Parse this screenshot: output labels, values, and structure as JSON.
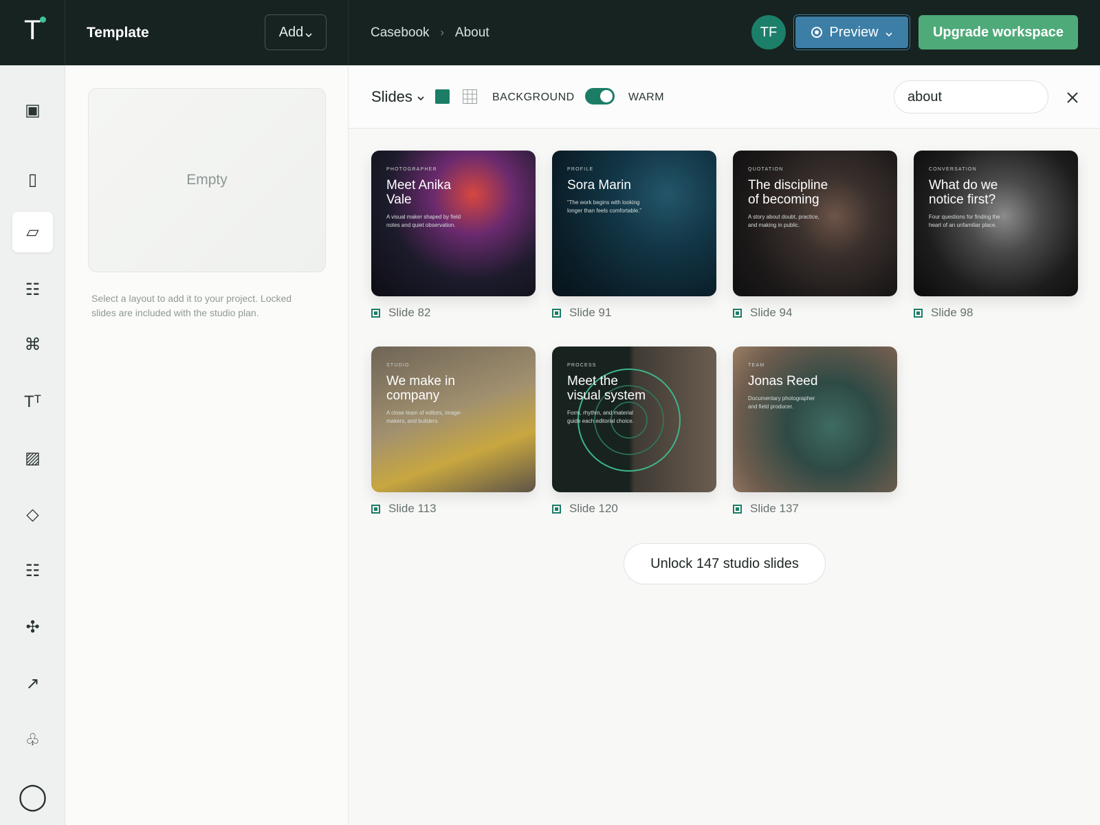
{
  "app": {
    "logo_letter": "T",
    "template_title": "Template",
    "add_label": "Add",
    "breadcrumbs": [
      "Casebook",
      "About"
    ],
    "avatar_initials": "TF",
    "preview_label": "Preview",
    "upgrade_label": "Upgrade workspace"
  },
  "rail": {
    "items": [
      {
        "name": "frame-icon",
        "glyph": "▣"
      },
      {
        "name": "column-icon",
        "glyph": "▯"
      },
      {
        "name": "parallelogram-icon",
        "glyph": "▱",
        "active": true
      },
      {
        "name": "list-icon",
        "glyph": "☷"
      },
      {
        "name": "command-icon",
        "glyph": "⌘"
      },
      {
        "name": "text-size-icon",
        "glyph": "Tᵀ"
      },
      {
        "name": "pattern-icon",
        "glyph": "▨"
      },
      {
        "name": "diamond-icon",
        "glyph": "◇"
      },
      {
        "name": "list-alt-icon",
        "glyph": "☷"
      },
      {
        "name": "nodes-icon",
        "glyph": "✣"
      },
      {
        "name": "arrow-icon",
        "glyph": "↗"
      },
      {
        "name": "club-icon",
        "glyph": "♧"
      },
      {
        "name": "circle-icon",
        "glyph": "◯"
      }
    ]
  },
  "panel": {
    "empty_label": "Empty",
    "note": "Select a layout to add it to your project. Locked slides are included with the studio plan."
  },
  "toolbar": {
    "slides_label": "Slides",
    "background_label": "BACKGROUND",
    "warm_label": "WARM",
    "search_value": "about",
    "search_placeholder": "Search",
    "toggle_on": true
  },
  "slides": [
    {
      "kicker": "PHOTOGRAPHER",
      "headline": "Meet Anika Vale",
      "blurb": "A visual maker shaped by field notes and quiet observation.",
      "label": "Slide 82",
      "bg": "radial-gradient(circle at 62% 30%, #d7473f 0%, #6a2a6e 28%, #1c1b2b 60%, #0d0d14 100%)"
    },
    {
      "kicker": "PROFILE",
      "headline": "Sora Marin",
      "blurb": "“The work begins with looking longer than feels comfortable.”",
      "label": "Slide 91",
      "bg": "radial-gradient(circle at 70% 30%, #23566a 0%, #123646 35%, #0a1d27 75%, #07131a 100%)"
    },
    {
      "kicker": "QUOTATION",
      "headline": "The discipline of becoming",
      "blurb": "A story about doubt, practice, and making in public.",
      "label": "Slide 94",
      "bg": "radial-gradient(circle at 62% 45%, #6d5448 0%, #3a302c 30%, #1b1818 70%, #101010 100%)"
    },
    {
      "kicker": "CONVERSATION",
      "headline": "What do we notice first?",
      "blurb": "Four questions for finding the heart of an unfamiliar place.",
      "label": "Slide 98",
      "bg": "radial-gradient(circle at 55% 45%, #8a8a8a 0%, #4a4a4a 30%, #1d1d1d 65%, #0b0b0b 100%)"
    },
    {
      "kicker": "STUDIO",
      "headline": "We make in company",
      "blurb": "A close team of editors, image-makers, and builders.",
      "label": "Slide 113",
      "bg": "linear-gradient(160deg, #6f6556 0%, #a1906f 45%, #c8a740 70%, #5d5447 100%)"
    },
    {
      "kicker": "PROCESS",
      "headline": "Meet the visual system",
      "blurb": "Form, rhythm, and material guide each editorial choice.",
      "label": "Slide 120",
      "bg": "linear-gradient(90deg, #18231f 0%, #18231f 47%, #3f3a33 50%, #6a5d50 100%)",
      "rings": true
    },
    {
      "kicker": "TEAM",
      "headline": "Jonas Reed",
      "blurb": "Documentary photographer and field producer.",
      "label": "Slide 137",
      "bg": "radial-gradient(circle at 60% 55%, #3e6b62 0%, #2f4a45 35%, #6f5d4e 75%, #9a7e65 100%)"
    }
  ],
  "unlock_label": "Unlock 147 studio slides",
  "colors": {
    "accent": "#1b7d66",
    "upgrade": "#4faa79",
    "preview": "#3c7ea6",
    "topbar": "#172321"
  }
}
